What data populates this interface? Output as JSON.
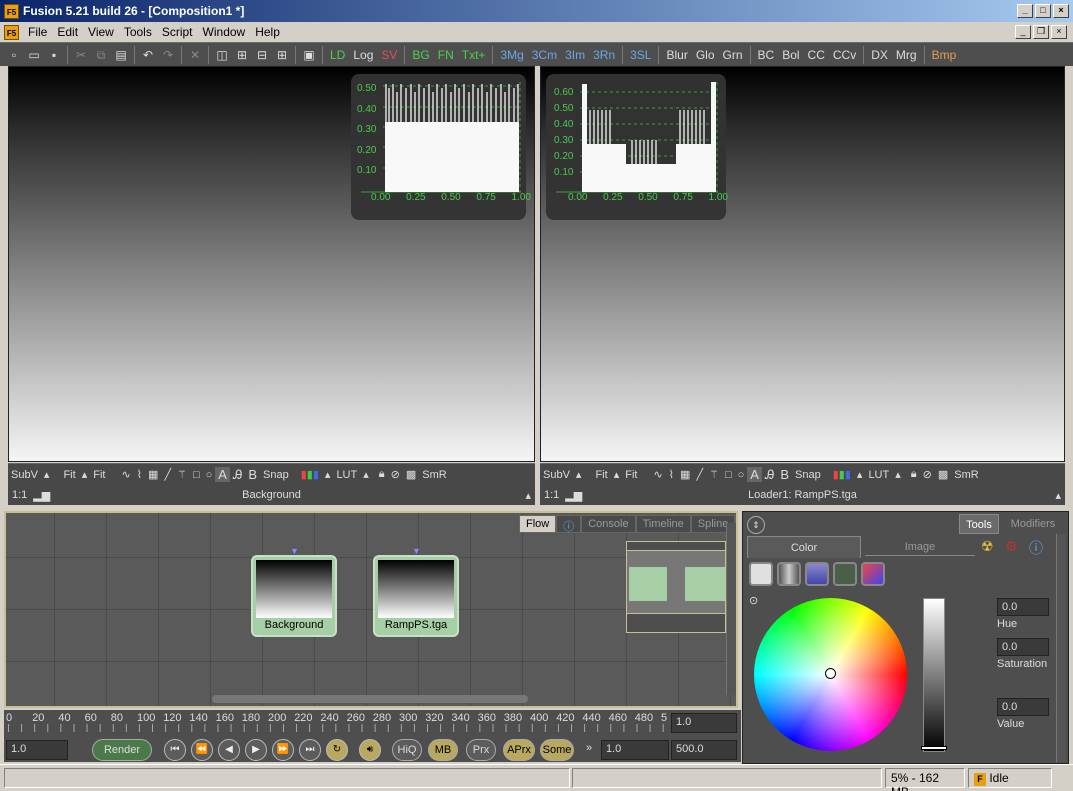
{
  "window": {
    "title": "Fusion 5.21 build 26 - [Composition1 *]"
  },
  "menu": [
    "File",
    "Edit",
    "View",
    "Tools",
    "Script",
    "Window",
    "Help"
  ],
  "toolbar": {
    "tools": [
      "LD",
      "Log",
      "SV",
      "BG",
      "FN",
      "Txt+",
      "3Mg",
      "3Cm",
      "3Im",
      "3Rn",
      "3SL",
      "Blur",
      "Glo",
      "Grn",
      "BC",
      "Bol",
      "CC",
      "CCv",
      "DX",
      "Mrg",
      "Bmp"
    ],
    "tool_colors": {
      "green": "#4cd04c",
      "red": "#e05050",
      "blue": "#6aa8e8",
      "white": "#e0e0e0",
      "orange": "#e0a050"
    }
  },
  "viewers": {
    "left": {
      "subv": "SubV",
      "fit1": "Fit",
      "fit2": "Fit",
      "snap": "Snap",
      "lut": "LUT",
      "smr": "SmR",
      "ratio": "1:1",
      "label": "Background",
      "a": "A",
      "b": "B",
      "histo": {
        "y_ticks": [
          "0.50",
          "0.40",
          "0.30",
          "0.20",
          "0.10"
        ],
        "x_ticks": [
          "0.00",
          "0.25",
          "0.50",
          "0.75",
          "1.00"
        ]
      }
    },
    "right": {
      "subv": "SubV",
      "fit1": "Fit",
      "fit2": "Fit",
      "snap": "Snap",
      "lut": "LUT",
      "smr": "SmR",
      "ratio": "1:1",
      "label": "Loader1: RampPS.tga",
      "a": "A",
      "b": "B",
      "histo": {
        "y_ticks": [
          "0.60",
          "0.50",
          "0.40",
          "0.30",
          "0.20",
          "0.10"
        ],
        "x_ticks": [
          "0.00",
          "0.25",
          "0.50",
          "0.75",
          "1.00"
        ]
      }
    }
  },
  "flow": {
    "tabs": [
      "Flow",
      "Console",
      "Timeline",
      "Spline"
    ],
    "nodes": [
      {
        "name": "Background"
      },
      {
        "name": "RampPS.tga"
      }
    ]
  },
  "timeline": {
    "ticks": [
      "0",
      "20",
      "40",
      "60",
      "80",
      "100",
      "120",
      "140",
      "160",
      "180",
      "200",
      "220",
      "240",
      "260",
      "280",
      "300",
      "320",
      "340",
      "360",
      "380",
      "400",
      "420",
      "440",
      "460",
      "480",
      "5"
    ],
    "current": "1.0",
    "start": "1.0",
    "render_start": "1.0",
    "end": "500.0",
    "render_label": "Render",
    "toggles": [
      "HiQ",
      "MB",
      "Prx",
      "APrx",
      "Some"
    ]
  },
  "inspector": {
    "tabs": [
      "Tools",
      "Modifiers"
    ],
    "subtabs": [
      "Color",
      "Image"
    ],
    "hue": {
      "label": "Hue",
      "value": "0.0"
    },
    "saturation": {
      "label": "Saturation",
      "value": "0.0"
    },
    "value": {
      "label": "Value",
      "value": "0.0"
    }
  },
  "status": {
    "memory": "5% - 162 MB",
    "state": "Idle"
  }
}
